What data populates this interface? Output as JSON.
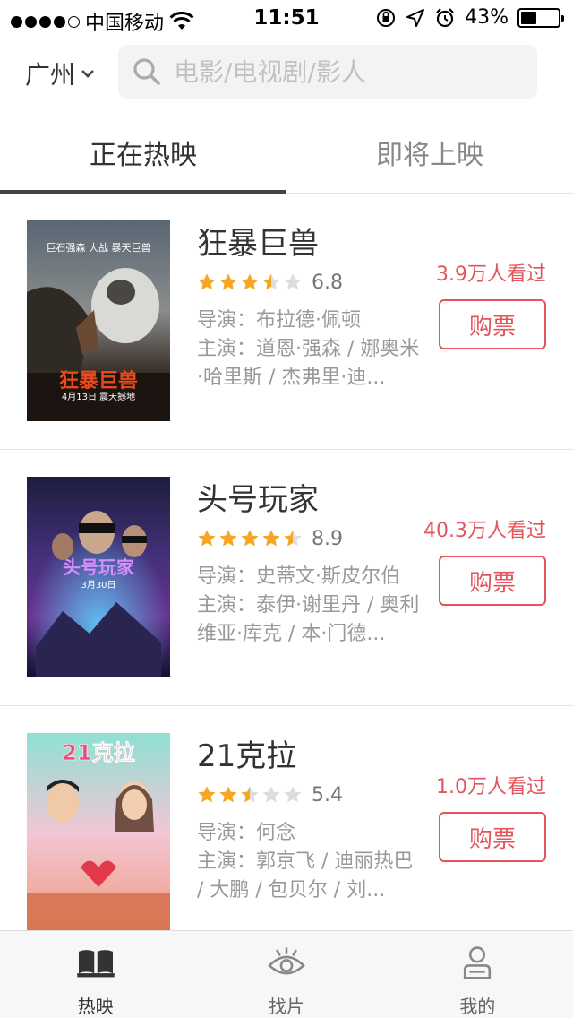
{
  "status_bar": {
    "carrier": "中国移动",
    "time": "11:51",
    "battery": "43%",
    "battery_level": 0.43
  },
  "header": {
    "city": "广州",
    "search_placeholder": "电影/电视剧/影人"
  },
  "tabs": [
    {
      "label": "正在热映",
      "active": true
    },
    {
      "label": "即将上映",
      "active": false
    }
  ],
  "movies": [
    {
      "title": "狂暴巨兽",
      "rating_stars": 3.5,
      "score": "6.8",
      "director_label": "导演：",
      "director": "布拉德·佩顿",
      "cast_label": "主演：",
      "cast": "道恩·强森 / 娜奥米·哈里斯 / 杰弗里·迪...",
      "watched": "3.9万人看过",
      "buy_label": "购票"
    },
    {
      "title": "头号玩家",
      "rating_stars": 4.5,
      "score": "8.9",
      "director_label": "导演：",
      "director": "史蒂文·斯皮尔伯",
      "cast_label": "主演：",
      "cast": "泰伊·谢里丹 / 奥利维亚·库克 / 本·门德...",
      "watched": "40.3万人看过",
      "buy_label": "购票"
    },
    {
      "title": "21克拉",
      "rating_stars": 2.5,
      "score": "5.4",
      "director_label": "导演：",
      "director": "何念",
      "cast_label": "主演：",
      "cast": "郭京飞 / 迪丽热巴 / 大鹏 / 包贝尔 / 刘...",
      "watched": "1.0万人看过",
      "buy_label": "购票"
    }
  ],
  "posters": [
    {
      "text_main": "狂暴巨兽",
      "text_date": "4月13日 震天撼地",
      "text_top": "巨石强森 大战 暴天巨兽"
    },
    {
      "text_main": "头号玩家",
      "text_date": "3月30日"
    },
    {
      "text_main": "21克拉"
    }
  ],
  "bottom_nav": [
    {
      "label": "热映",
      "icon": "book-icon",
      "active": true
    },
    {
      "label": "找片",
      "icon": "eye-icon",
      "active": false
    },
    {
      "label": "我的",
      "icon": "person-icon",
      "active": false
    }
  ],
  "colors": {
    "accent": "#e2565b",
    "star": "#f5a623",
    "star_empty": "#dddddd"
  }
}
